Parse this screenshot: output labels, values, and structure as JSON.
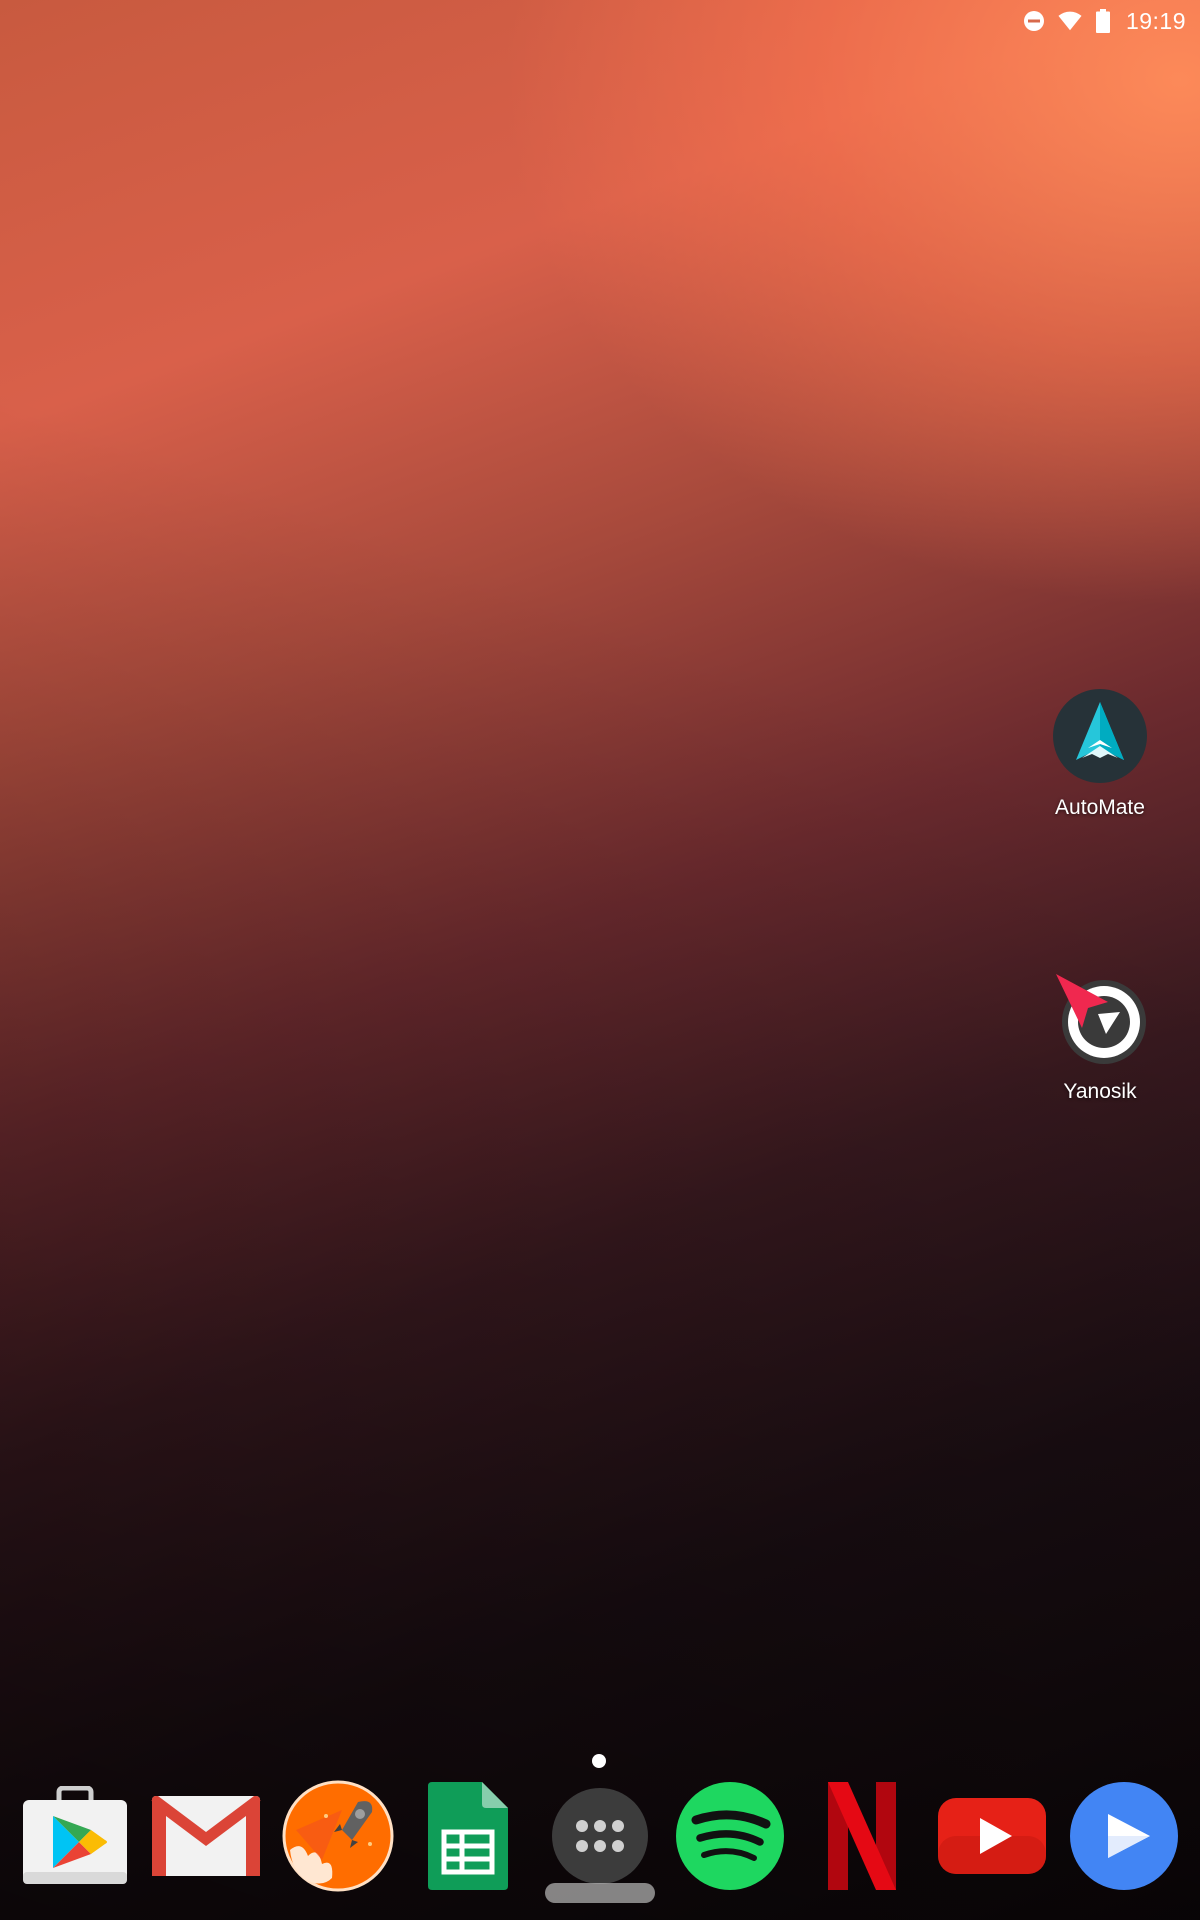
{
  "status_bar": {
    "time": "19:19",
    "icons": [
      "do-not-disturb-icon",
      "wifi-icon",
      "battery-icon"
    ]
  },
  "desktop": {
    "apps": [
      {
        "name": "automate",
        "label": "AutoMate",
        "icon": "automate-icon"
      },
      {
        "name": "yanosik",
        "label": "Yanosik",
        "icon": "yanosik-icon"
      }
    ]
  },
  "page_indicator": {
    "current_page": 1,
    "total_pages": 1
  },
  "dock": {
    "apps": [
      {
        "name": "play-store",
        "icon": "play-store-icon"
      },
      {
        "name": "gmail",
        "icon": "gmail-icon"
      },
      {
        "name": "rocket-launcher",
        "icon": "rocket-icon"
      },
      {
        "name": "google-sheets",
        "icon": "sheets-icon"
      },
      {
        "name": "app-drawer",
        "icon": "app-drawer-icon"
      },
      {
        "name": "spotify",
        "icon": "spotify-icon"
      },
      {
        "name": "netflix",
        "icon": "netflix-icon"
      },
      {
        "name": "youtube",
        "icon": "youtube-icon"
      },
      {
        "name": "play-movies",
        "icon": "play-movies-icon"
      }
    ]
  },
  "colors": {
    "wallpaper_top": "#f57a55",
    "wallpaper_bottom": "#0d0709",
    "text": "#ffffff"
  }
}
